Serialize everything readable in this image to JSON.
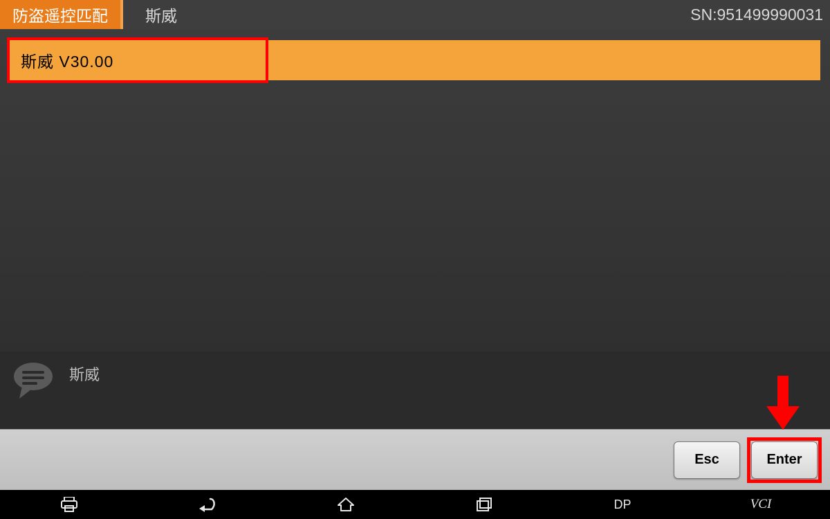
{
  "header": {
    "tab_label": "防盗遥控匹配",
    "brand_label": "斯威",
    "sn_label": "SN:951499990031"
  },
  "list": {
    "items": [
      {
        "label": "斯威  V30.00",
        "selected": true,
        "highlighted": true
      }
    ]
  },
  "status": {
    "text": "斯威",
    "icon_name": "chat-icon"
  },
  "buttons": {
    "esc_label": "Esc",
    "enter_label": "Enter"
  },
  "annotations": {
    "enter_highlighted": true,
    "arrow_points_to": "enter-button"
  },
  "nav": {
    "items": [
      {
        "name": "print-icon",
        "kind": "icon"
      },
      {
        "name": "back-icon",
        "kind": "icon"
      },
      {
        "name": "home-icon",
        "kind": "icon"
      },
      {
        "name": "recent-icon",
        "kind": "icon"
      },
      {
        "name": "dp-label",
        "kind": "text",
        "label": "DP"
      },
      {
        "name": "vci-label",
        "kind": "text",
        "label": "VCI"
      }
    ]
  },
  "colors": {
    "accent_orange": "#e87b1a",
    "row_orange": "#f5a43b",
    "highlight_red": "#ff0000"
  }
}
